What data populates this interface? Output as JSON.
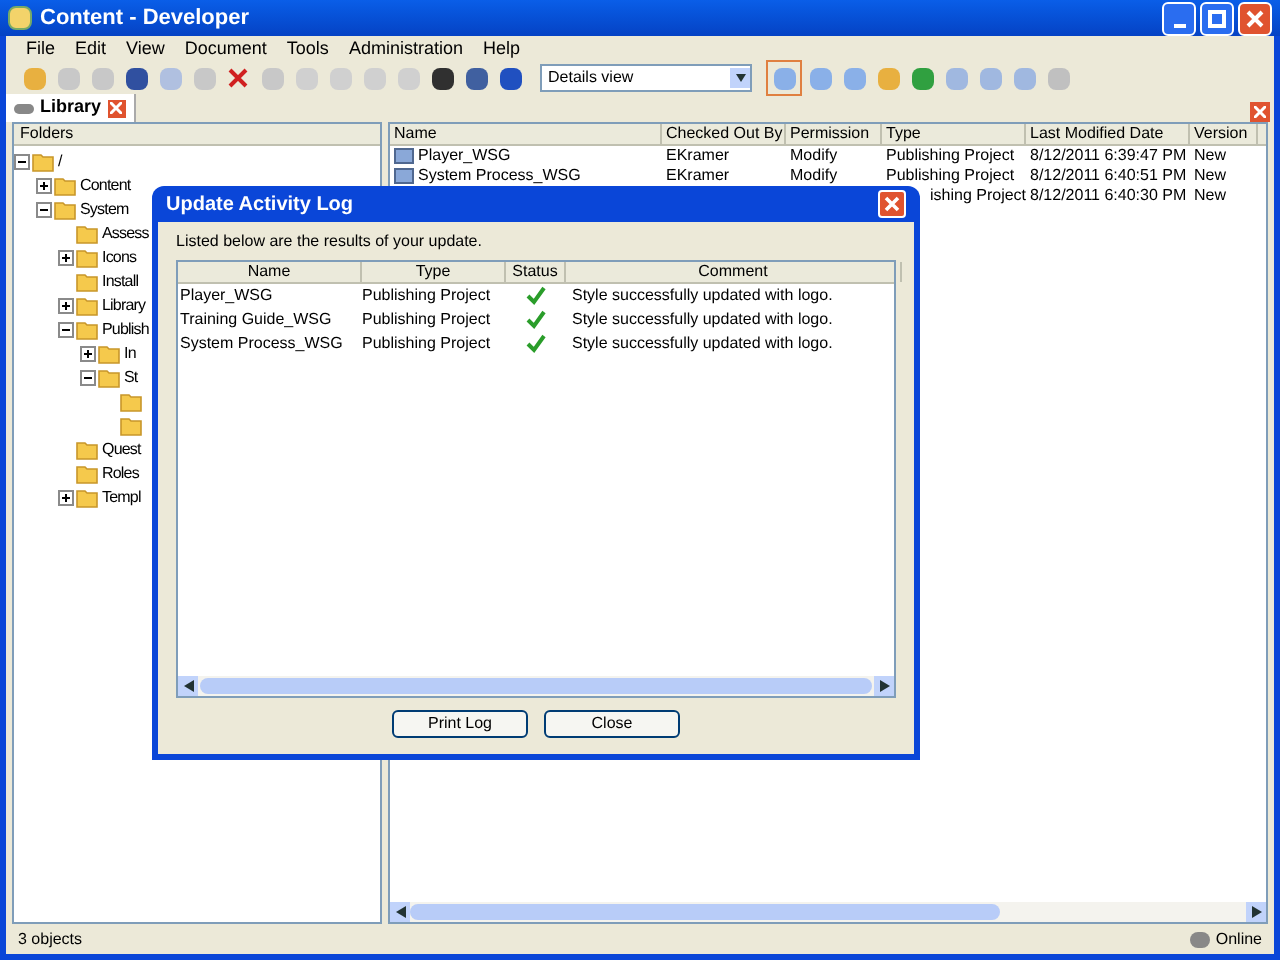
{
  "window": {
    "title": "Content - Developer"
  },
  "menu": [
    "File",
    "Edit",
    "View",
    "Document",
    "Tools",
    "Administration",
    "Help"
  ],
  "toolbar": {
    "view_select": "Details view"
  },
  "tab": {
    "label": "Library",
    "selected": true
  },
  "folders": {
    "header": "Folders",
    "tree": [
      {
        "label": "/",
        "expanded": true,
        "children": [
          {
            "label": "Content",
            "expanded": false
          },
          {
            "label": "System",
            "expanded": true,
            "children": [
              {
                "label": "Assess"
              },
              {
                "label": "Icons",
                "expanded": false
              },
              {
                "label": "Install"
              },
              {
                "label": "Library",
                "expanded": false
              },
              {
                "label": "Publish",
                "expanded": true,
                "children": [
                  {
                    "label": "In",
                    "expanded": false
                  },
                  {
                    "label": "St",
                    "expanded": true,
                    "children": [
                      {
                        "kind": "folder"
                      },
                      {
                        "kind": "folder"
                      }
                    ]
                  }
                ]
              },
              {
                "label": "Quest"
              },
              {
                "label": "Roles"
              },
              {
                "label": "Templ",
                "expanded": false
              }
            ]
          }
        ]
      }
    ]
  },
  "list": {
    "columns": [
      "Name",
      "Checked Out By",
      "Permission",
      "Type",
      "Last Modified Date",
      "Version"
    ],
    "rows": [
      {
        "name": "Player_WSG",
        "checked_out_by": "EKramer",
        "permission": "Modify",
        "type": "Publishing Project",
        "date": "8/12/2011 6:39:47 PM",
        "version": "New"
      },
      {
        "name": "System Process_WSG",
        "checked_out_by": "EKramer",
        "permission": "Modify",
        "type": "Publishing Project",
        "date": "8/12/2011 6:40:51 PM",
        "version": "New"
      },
      {
        "type": "ishing Project",
        "date": "8/12/2011 6:40:30 PM",
        "version": "New"
      }
    ]
  },
  "status_bar": {
    "count": "3 objects",
    "connection": "Online"
  },
  "dialog": {
    "title": "Update Activity Log",
    "intro": "Listed below are the results of your update.",
    "columns": [
      "Name",
      "Type",
      "Status",
      "Comment"
    ],
    "rows": [
      {
        "name": "Player_WSG",
        "type": "Publishing Project",
        "success": true,
        "comment": "Style successfully updated with logo."
      },
      {
        "name": "Training Guide_WSG",
        "type": "Publishing Project",
        "success": true,
        "comment": "Style successfully updated with logo."
      },
      {
        "name": "System Process_WSG",
        "type": "Publishing Project",
        "success": true,
        "comment": "Style successfully updated with logo."
      }
    ],
    "buttons": [
      "Print Log",
      "Close"
    ]
  }
}
